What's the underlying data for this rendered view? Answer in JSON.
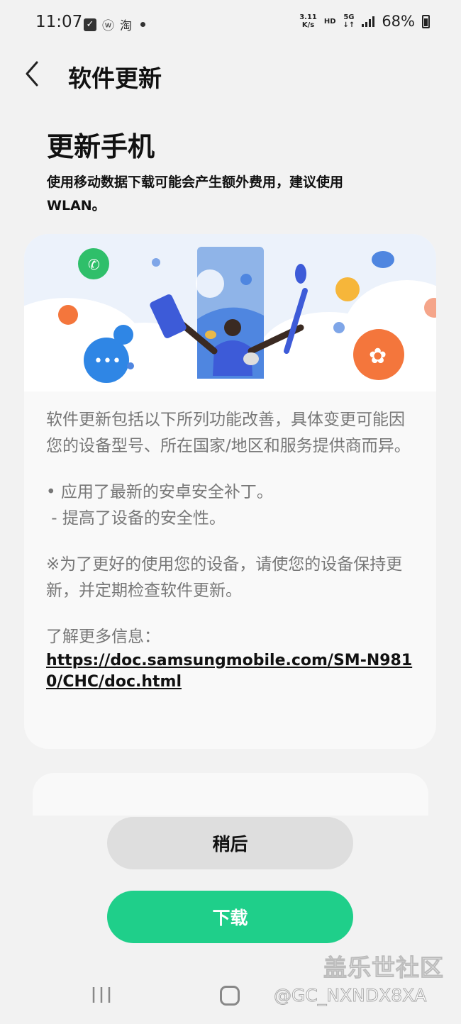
{
  "status_bar": {
    "time": "11:07",
    "app_icons": [
      "checkbox-icon",
      "weibo-icon",
      "taobao-icon"
    ],
    "weibo_glyph": "ⓦ",
    "taobao_glyph": "淘",
    "net_speed_value": "3.11",
    "net_speed_unit": "K/s",
    "hd_label": "HD",
    "network_label": "5G",
    "network_arrows": "↓↑",
    "battery_percent": "68%"
  },
  "header": {
    "title": "软件更新"
  },
  "page": {
    "title": "更新手机",
    "notice": "使用移动数据下载可能会产生额外费用，建议使用WLAN。"
  },
  "card": {
    "intro": "软件更新包括以下所列功能改善，具体变更可能因您的设备型号、所在国家/地区和服务提供商而异。",
    "bullet_1": "• 应用了最新的安卓安全补丁。",
    "bullet_2": " - 提高了设备的安全性。",
    "advice": "※为了更好的使用您的设备，请使您的设备保持更新，并定期检查软件更新。",
    "more_info_label": "了解更多信息：",
    "more_info_link": "https://doc.samsungmobile.com/SM-N9810/CHC/doc.html"
  },
  "buttons": {
    "later": "稍后",
    "download": "下载"
  },
  "watermark": {
    "brand": "盖乐世社区",
    "user": "@GC_NXNDX8XA"
  },
  "colors": {
    "background": "#f2f2f2",
    "card": "#f9f9f9",
    "download_accent": "#1fcf8a",
    "later_button": "#dedede",
    "secondary_text": "#777777"
  }
}
